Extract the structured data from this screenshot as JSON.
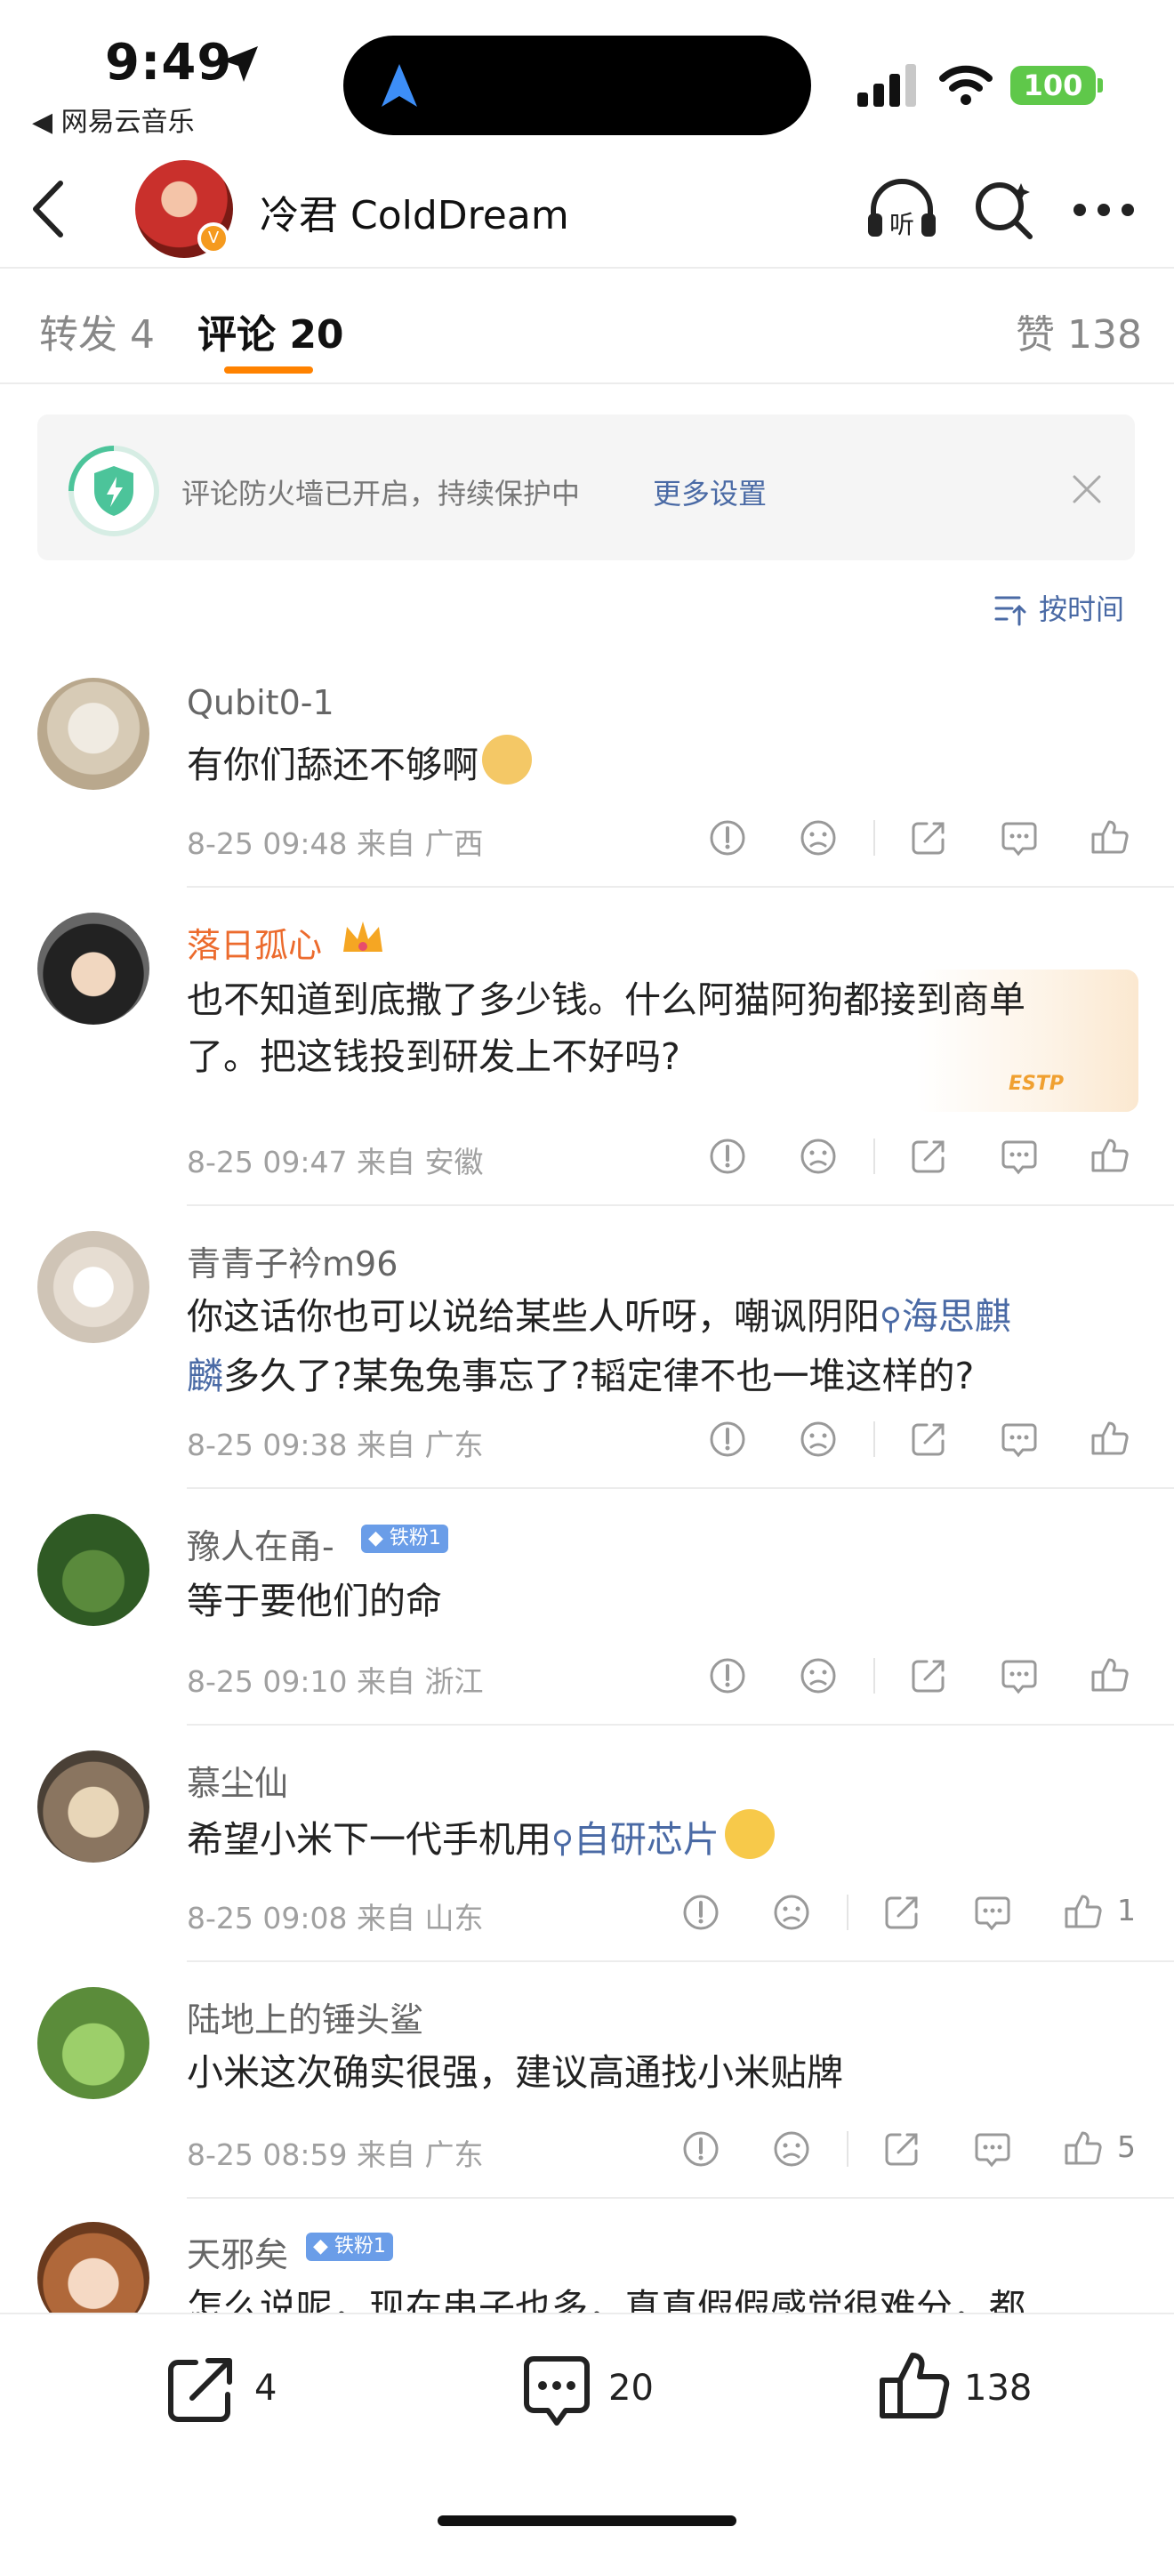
{
  "status_bar": {
    "time": "9:49",
    "back_app": "◀ 网易云音乐",
    "battery": "100"
  },
  "nav": {
    "title": "冷君 ColdDream"
  },
  "tabs": [
    {
      "label": "转发 4"
    },
    {
      "label": "评论 20"
    },
    {
      "label": "赞 138"
    }
  ],
  "banner": {
    "text": "评论防火墙已开启，持续保护中",
    "link": "更多设置"
  },
  "sort": {
    "label": "按时间"
  },
  "comments": [
    {
      "name": "Qubit0-1",
      "body": "有你们舔还不够啊",
      "meta": "8-25 09:48 来自 广西",
      "likes": ""
    },
    {
      "name": "落日孤心",
      "body_1": "也不知道到底撒了多少钱。什么阿猫阿狗都接到商单",
      "body_2": "了。把这钱投到研发上不好吗?",
      "meta": "8-25 09:47 来自 安徽",
      "sticker": "ESTP",
      "likes": ""
    },
    {
      "name": "青青子衿m96",
      "body_1a": "你这话你也可以说给某些人听呀，嘲讽阴阳",
      "body_1b": "海思麒",
      "body_2a": "麟",
      "body_2b": "多久了?某兔兔事忘了?韬定律不也一堆这样的?",
      "meta": "8-25 09:38 来自 广东",
      "likes": ""
    },
    {
      "name": "豫人在甬-",
      "badge": "铁粉1",
      "body": "等于要他们的命",
      "meta": "8-25 09:10 来自 浙江",
      "likes": ""
    },
    {
      "name": "慕尘仙",
      "body_a": "希望小米下一代手机用",
      "body_b": "自研芯片",
      "meta": "8-25 09:08 来自 山东",
      "likes": "1"
    },
    {
      "name": "陆地上的锤头鲨",
      "body": "小米这次确实很强，建议高通找小米贴牌",
      "meta": "8-25 08:59 来自 广东",
      "likes": "5"
    },
    {
      "name": "天邪矣",
      "badge": "铁粉1",
      "body": "怎么说呢，现在串子也多，真真假假感觉很难分，都"
    }
  ],
  "bottom_bar": {
    "reposts": "4",
    "comments": "20",
    "likes": "138"
  },
  "colors": {
    "accent": "#ff8200",
    "link": "#4a6aa5",
    "badge": "#6a9de8",
    "battery": "#5fc84a"
  }
}
